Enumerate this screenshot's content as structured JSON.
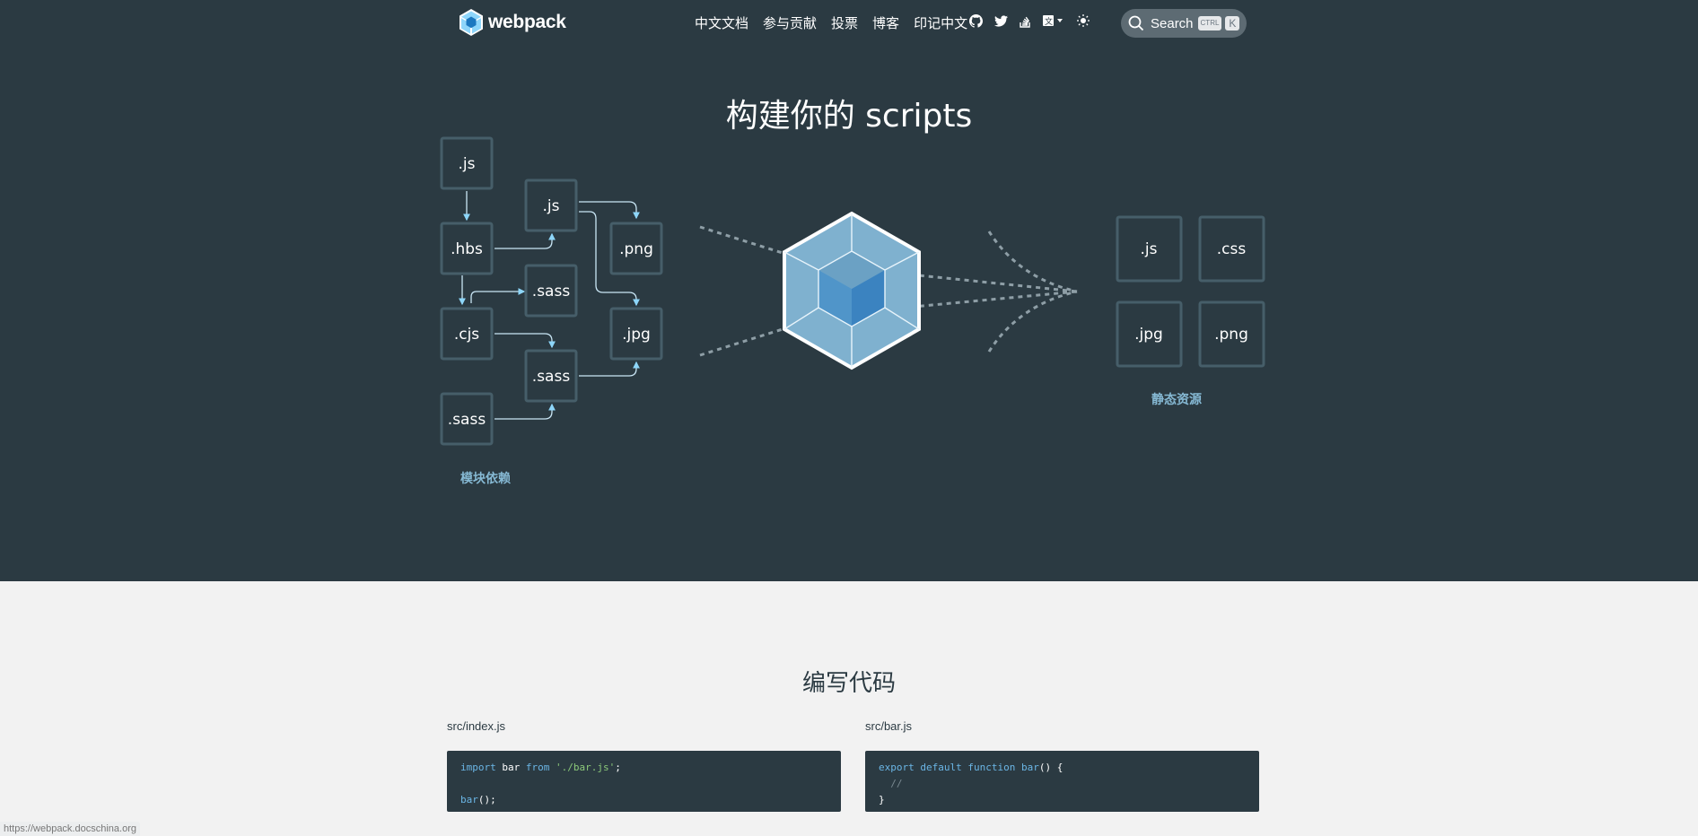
{
  "nav": {
    "logo": "webpack",
    "links": [
      "中文文档",
      "参与贡献",
      "投票",
      "博客",
      "印记中文"
    ],
    "icons": [
      "github-icon",
      "twitter-icon",
      "stack-overflow-icon",
      "language-icon",
      "theme-toggle-icon"
    ],
    "search": {
      "label": "Search",
      "key_modifier": "CTRL",
      "key": "K"
    }
  },
  "hero": {
    "title": "构建你的 scripts",
    "modules": [
      ".js",
      ".hbs",
      ".js",
      ".png",
      ".sass",
      ".cjs",
      ".jpg",
      ".sass",
      ".sass"
    ],
    "modules_caption": "模块依赖",
    "assets": [
      ".js",
      ".css",
      ".jpg",
      ".png"
    ],
    "assets_caption": "静态资源"
  },
  "write": {
    "title": "编写代码",
    "left": {
      "filename": "src/index.js",
      "lines": [
        [
          {
            "t": "import",
            "c": "kw"
          },
          {
            "t": " bar "
          },
          {
            "t": "from",
            "c": "kw"
          },
          {
            "t": " "
          },
          {
            "t": "'./bar.js'",
            "c": "str"
          },
          {
            "t": ";"
          }
        ],
        [
          {
            "t": ""
          }
        ],
        [
          {
            "t": "bar",
            "c": "kw"
          },
          {
            "t": "();"
          }
        ]
      ]
    },
    "right": {
      "filename": "src/bar.js",
      "lines": [
        [
          {
            "t": "export",
            "c": "kw"
          },
          {
            "t": " "
          },
          {
            "t": "default",
            "c": "kw"
          },
          {
            "t": " "
          },
          {
            "t": "function",
            "c": "kw"
          },
          {
            "t": " "
          },
          {
            "t": "bar",
            "c": "kw"
          },
          {
            "t": "() {"
          }
        ],
        [
          {
            "t": "  "
          },
          {
            "t": "//",
            "c": "cm"
          }
        ],
        [
          {
            "t": "}"
          }
        ]
      ]
    }
  },
  "status_url": "https://webpack.docschina.org",
  "colors": {
    "hero_bg": "#2b3a42",
    "box_border": "#465e69",
    "accent": "#8dd6f9",
    "caption": "#86b9d4"
  }
}
